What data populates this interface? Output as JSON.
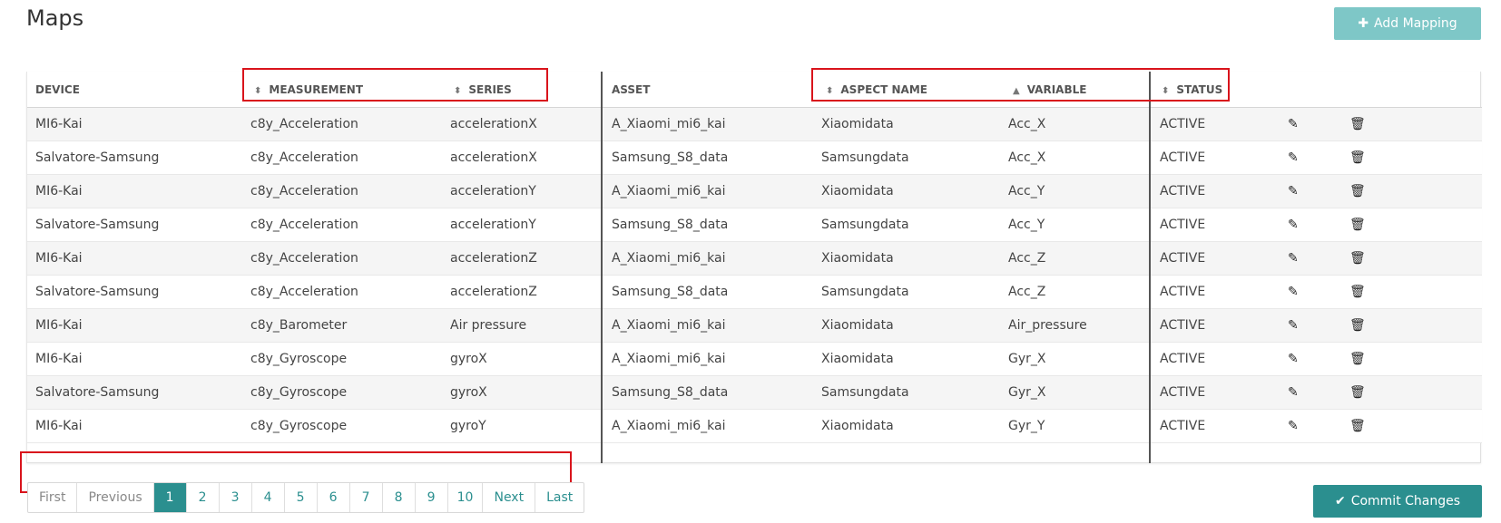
{
  "page": {
    "title": "Maps"
  },
  "actions": {
    "add_label": "Add Mapping",
    "commit_label": "Commit Changes"
  },
  "table": {
    "headers": [
      "DEVICE",
      "MEASUREMENT",
      "SERIES",
      "ASSET",
      "ASPECT NAME",
      "VARIABLE",
      "STATUS"
    ],
    "rows": [
      [
        "MI6-Kai",
        "c8y_Acceleration",
        "accelerationX",
        "A_Xiaomi_mi6_kai",
        "Xiaomidata",
        "Acc_X",
        "ACTIVE"
      ],
      [
        "Salvatore-Samsung",
        "c8y_Acceleration",
        "accelerationX",
        "Samsung_S8_data",
        "Samsungdata",
        "Acc_X",
        "ACTIVE"
      ],
      [
        "MI6-Kai",
        "c8y_Acceleration",
        "accelerationY",
        "A_Xiaomi_mi6_kai",
        "Xiaomidata",
        "Acc_Y",
        "ACTIVE"
      ],
      [
        "Salvatore-Samsung",
        "c8y_Acceleration",
        "accelerationY",
        "Samsung_S8_data",
        "Samsungdata",
        "Acc_Y",
        "ACTIVE"
      ],
      [
        "MI6-Kai",
        "c8y_Acceleration",
        "accelerationZ",
        "A_Xiaomi_mi6_kai",
        "Xiaomidata",
        "Acc_Z",
        "ACTIVE"
      ],
      [
        "Salvatore-Samsung",
        "c8y_Acceleration",
        "accelerationZ",
        "Samsung_S8_data",
        "Samsungdata",
        "Acc_Z",
        "ACTIVE"
      ],
      [
        "MI6-Kai",
        "c8y_Barometer",
        "Air pressure",
        "A_Xiaomi_mi6_kai",
        "Xiaomidata",
        "Air_pressure",
        "ACTIVE"
      ],
      [
        "MI6-Kai",
        "c8y_Gyroscope",
        "gyroX",
        "A_Xiaomi_mi6_kai",
        "Xiaomidata",
        "Gyr_X",
        "ACTIVE"
      ],
      [
        "Salvatore-Samsung",
        "c8y_Gyroscope",
        "gyroX",
        "Samsung_S8_data",
        "Samsungdata",
        "Gyr_X",
        "ACTIVE"
      ],
      [
        "MI6-Kai",
        "c8y_Gyroscope",
        "gyroY",
        "A_Xiaomi_mi6_kai",
        "Xiaomidata",
        "Gyr_Y",
        "ACTIVE"
      ]
    ]
  },
  "pagination": {
    "first": "First",
    "previous": "Previous",
    "next": "Next",
    "last": "Last",
    "pages": [
      "1",
      "2",
      "3",
      "4",
      "5",
      "6",
      "7",
      "8",
      "9",
      "10"
    ],
    "current": "1"
  },
  "colors": {
    "accent": "#2b8f8f",
    "accent_light": "#7ec7c7",
    "highlight": "#d9141c"
  },
  "icons": {
    "add": "plus-icon",
    "commit": "check-icon",
    "edit": "pencil-icon",
    "delete": "trash-icon",
    "sort": "sort-icon",
    "sort_asc": "sort-asc-icon"
  }
}
